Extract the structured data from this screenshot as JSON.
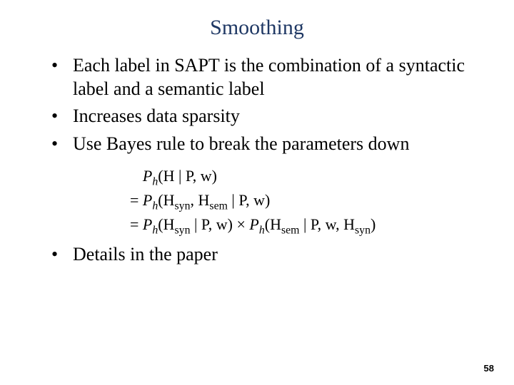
{
  "title": "Smoothing",
  "bullets": {
    "b1": "Each label in SAPT is the combination of a syntactic label and a semantic label",
    "b2": "Increases data sparsity",
    "b3": "Use Bayes rule to break the parameters down",
    "b4": "Details in the paper"
  },
  "formula": {
    "P": "P",
    "h": "h",
    "H": "H",
    "syn": "syn",
    "sem": "sem",
    "Pw": "P, w",
    "eq": "= ",
    "times": " × ",
    "open": "(",
    "close": ")",
    "bar": " | ",
    "comma": ", "
  },
  "page_number": "58"
}
